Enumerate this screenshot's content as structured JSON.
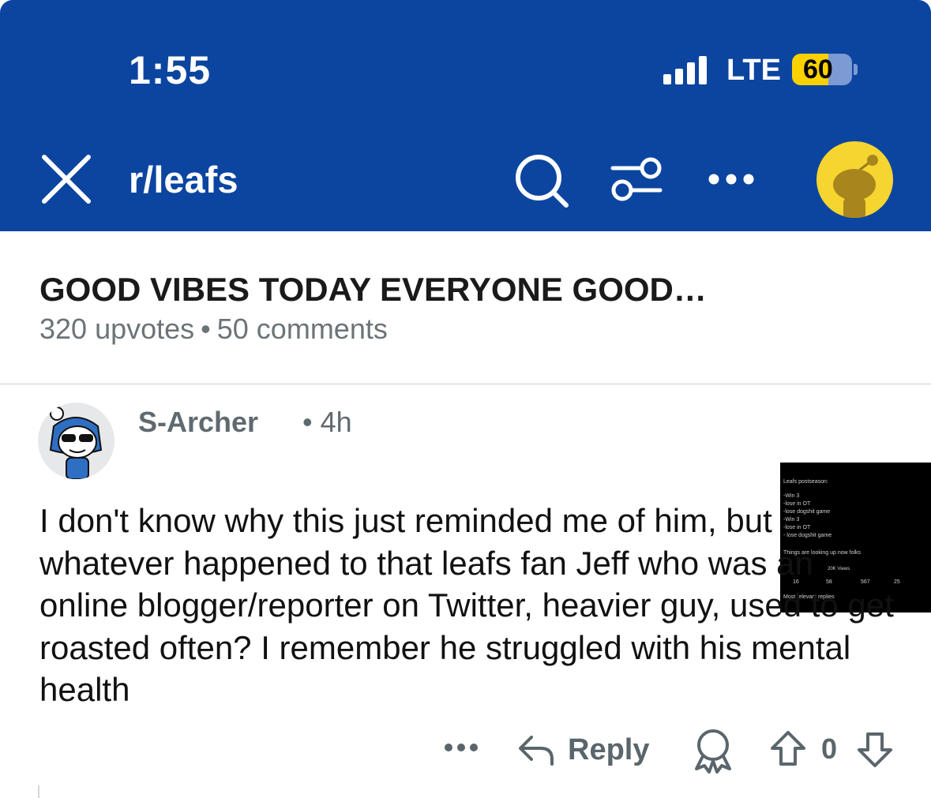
{
  "status_bar": {
    "time": "1:55",
    "network": "LTE",
    "battery": "60",
    "battery_level": 0.6,
    "signal_icon": "cellular-signal-icon"
  },
  "nav": {
    "title": "r/leafs",
    "close_icon": "close-icon",
    "search_icon": "search-icon",
    "filter_icon": "filter-icon",
    "more_icon": "more-icon",
    "avatar_icon": "user-avatar"
  },
  "post": {
    "title": "GOOD VIBES TODAY EVERYONE GOOD…",
    "upvotes": "320 upvotes",
    "separator": "•",
    "comments": "50 comments",
    "thumbnail_lines": [
      "Leafs postseason:",
      "-Win 3",
      "-lose in OT",
      "-lose dogshit game",
      "-Win 3",
      "-lose in OT",
      "- lose dogshit game",
      "Things are looking up now folks",
      "20K Views",
      "16",
      "58",
      "567",
      "25",
      "Most relevant replies"
    ]
  },
  "comment": {
    "author": "S-Archer",
    "separator": "•",
    "age": "4h",
    "body": "I don't know why this just reminded me of him, but whatever happened to that leafs fan Jeff who was an online blogger/reporter on Twitter, heavier guy, used to get roasted often? I remember he struggled with his mental health",
    "reply_label": "Reply",
    "score": "0"
  },
  "colors": {
    "header_bg": "#0c45a0",
    "battery_fill": "#fcd100",
    "avatar_bg": "#f6d530",
    "meta_text": "#6b7478"
  }
}
